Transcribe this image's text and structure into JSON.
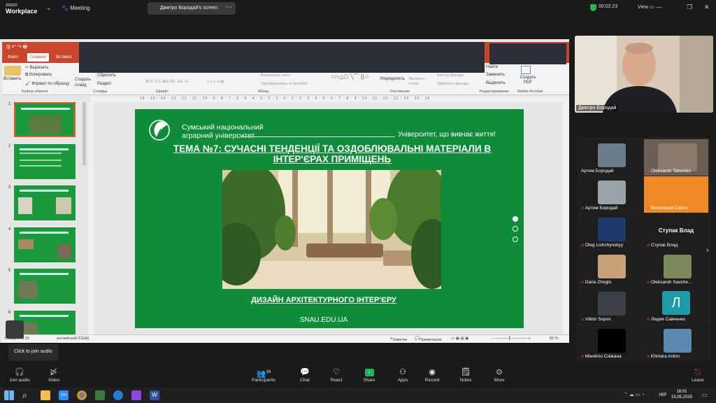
{
  "app": {
    "name_line1": "zoom",
    "name_line2": "Workplace",
    "meeting_label": "Meeting",
    "share_label": "Дмитро Бородай's screen",
    "timer": "00:02:23",
    "view_label": "View"
  },
  "ppt": {
    "tabs": [
      "Файл",
      "Главная",
      "Вставка"
    ],
    "ribbon": {
      "paste": "Вставить",
      "cut": "Вырезать",
      "copy": "Копировать",
      "format_painter": "Формат по образцу",
      "clipboard_group": "Буфер обмена",
      "new_slide": "Создать слайд",
      "reset": "Сбросить",
      "section": "Раздел",
      "slides_group": "Слайды",
      "font_group": "Шрифт",
      "align_text": "Выровнять текст",
      "smartart": "Преобразовать в SmartArt",
      "paragraph_group": "Абзац",
      "arrange": "Упорядочить",
      "quick_styles": "Экспресс-стили",
      "shape_outline": "Контур фигуры",
      "shape_effects": "Эффекты фигуры",
      "drawing_group": "Рисование",
      "find": "Найти",
      "replace": "Заменить",
      "select": "Выделить",
      "editing_group": "Редактирование",
      "create_pdf": "Создать PDF",
      "acrobat_group": "Adobe Acrobat"
    },
    "ruler_text": "16 · 15 · 14 · 13 · 12 · 11 · 10 · 9 · 8 · 7 · 6 · 5 · 4 · 3 · 2 · 1 · 0 · 1 · 2 · 3 · 4 · 5 · 6 · 7 · 8 · 9 · 10 · 11 · 12 · 13 · 14 · 15 · 16",
    "thumb_numbers": [
      "1",
      "2",
      "3",
      "4",
      "5",
      "6"
    ],
    "status": {
      "slide_info": "Слайд 1 из 20",
      "language": "английский (США)",
      "notes": "Заметки",
      "comments": "Примечания",
      "zoom": "83 %"
    }
  },
  "slide": {
    "university": "Сумський національний аграрний університет",
    "motto": "Університет, що вивчає життя!",
    "topic": "ТЕМА №7: СУЧАСНІ ТЕНДЕНЦІЇ ТА ОЗДОБЛЮВАЛЬНІ МАТЕРІАЛИ В ІНТЕР'ЄРАХ ПРИМІЩЕНЬ",
    "subtitle": "ДИЗАЙН АРХІТЕКТУРНОГО ІНТЕР'ЄРУ",
    "site": "SNAU.EDU.UA"
  },
  "speaker": {
    "name": "Дмитро Бородай"
  },
  "participants": [
    {
      "name": "Артем Бородай",
      "muted": false
    },
    {
      "name": "Oleksandr Tatsenko",
      "muted": true
    },
    {
      "name": "Артем Бородай",
      "muted": true
    },
    {
      "name": "Виленская Света",
      "muted": true
    },
    {
      "name": "Oleg Lishchynskyy",
      "muted": true
    },
    {
      "name": "Ступак Влад",
      "muted": true,
      "title": "Ступак Влад"
    },
    {
      "name": "Daria Zhoglo",
      "muted": true
    },
    {
      "name": "Oleksandr Savche...",
      "muted": true
    },
    {
      "name": "Viktor Sopov",
      "muted": true
    },
    {
      "name": "Лидия Савченко",
      "muted": true,
      "initial": "Л"
    },
    {
      "name": "Міняйло Сніжана",
      "muted": true
    },
    {
      "name": "Khmara Anton",
      "muted": true
    }
  ],
  "tooltip": "Click to join audio",
  "toolbar": {
    "join_audio": "Join audio",
    "video": "Video",
    "participants": "Participants",
    "participants_count": "16",
    "chat": "Chat",
    "react": "React",
    "share": "Share",
    "apps": "Apps",
    "record": "Record",
    "notes": "Notes",
    "more": "More",
    "leave": "Leave"
  },
  "taskbar": {
    "time": "16:01",
    "date": "15.05.2025",
    "lang": "УКР"
  },
  "colors": {
    "slide_green": "#0f8c3a",
    "ppt_accent": "#c8462b",
    "muted_red": "#e03b3b",
    "share_green": "#2fb14c"
  }
}
